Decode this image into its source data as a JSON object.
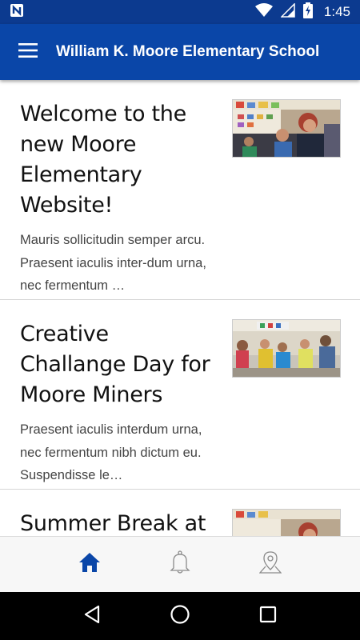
{
  "status_bar": {
    "time": "1:45",
    "icons": [
      "n-notification-icon",
      "wifi-icon",
      "signal-icon",
      "battery-charging-icon"
    ]
  },
  "app_bar": {
    "title": "William K. Moore Elementary School",
    "menu_icon": "hamburger-menu-icon"
  },
  "articles": [
    {
      "title": "Welcome to the new Moore Elementary Website!",
      "excerpt": "Mauris sollicitudin semper arcu. Praesent iaculis inter-dum urna, nec fermentum …"
    },
    {
      "title": "Creative Challange Day for Moore Miners",
      "excerpt": "Praesent iaculis interdum urna, nec fermentum nibh dictum eu. Suspendisse le…"
    },
    {
      "title": "Summer Break at",
      "excerpt": ""
    }
  ],
  "bottom_nav": {
    "items": [
      {
        "icon": "home-icon",
        "active": true
      },
      {
        "icon": "bell-icon",
        "active": false
      },
      {
        "icon": "map-pin-icon",
        "active": false
      }
    ],
    "active_color": "#0a46a8",
    "inactive_color": "#8a8a8a"
  },
  "system_nav": {
    "icons": [
      "back-icon",
      "home-circle-icon",
      "recents-icon"
    ]
  },
  "colors": {
    "primary": "#0a46a8",
    "status_bar": "#0c3a8f"
  }
}
